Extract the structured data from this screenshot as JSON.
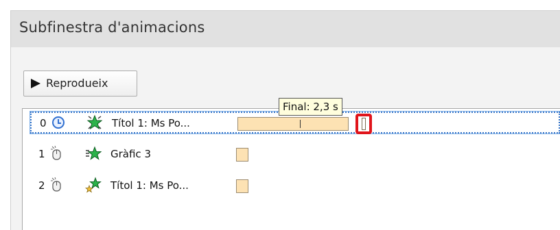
{
  "pane": {
    "title": "Subfinestra d'animacions"
  },
  "toolbar": {
    "play_label": "Reprodueix"
  },
  "tooltip": {
    "text": "Final: 2,3 s"
  },
  "animations": [
    {
      "index": "0",
      "trigger_icon": "clock-icon",
      "effect_icon": "star-spin-icon",
      "label": "Títol 1: Ms Po...",
      "selected": true
    },
    {
      "index": "1",
      "trigger_icon": "mouse-click-icon",
      "effect_icon": "star-emphasis-icon",
      "label": "Gràfic 3",
      "selected": false
    },
    {
      "index": "2",
      "trigger_icon": "mouse-click-icon",
      "effect_icon": "star-motion-icon",
      "label": "Títol 1: Ms Po...",
      "selected": false
    }
  ],
  "colors": {
    "header_bg": "#e1e1e1",
    "timebar_fill": "#fde2b3",
    "selection_border": "#3a77c8",
    "highlight": "#e0141b"
  }
}
